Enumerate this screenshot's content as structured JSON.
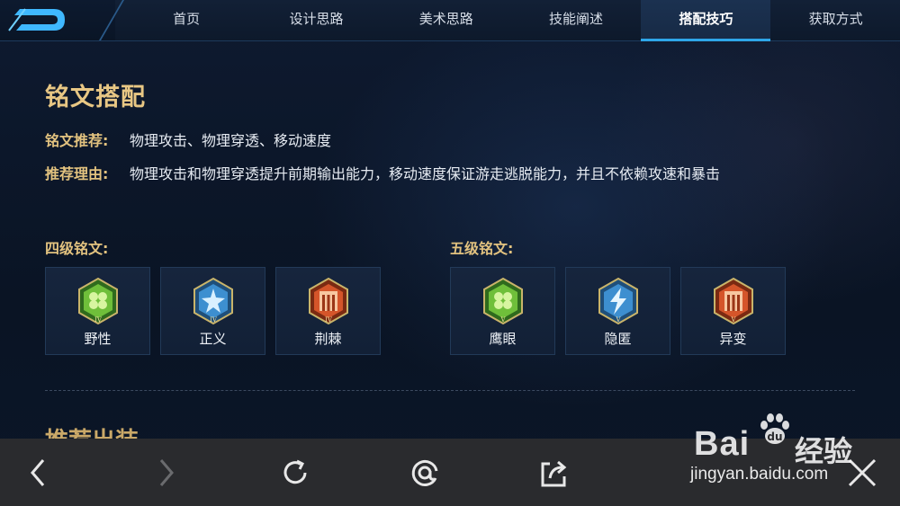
{
  "nav": {
    "tabs": [
      {
        "label": "首页"
      },
      {
        "label": "设计思路"
      },
      {
        "label": "美术思路"
      },
      {
        "label": "技能阐述"
      },
      {
        "label": "搭配技巧"
      },
      {
        "label": "获取方式"
      }
    ],
    "active_index": 4,
    "accent": "#2ea6e8"
  },
  "section": {
    "title": "铭文搭配",
    "recommend_label": "铭文推荐:",
    "recommend_value": "物理攻击、物理穿透、移动速度",
    "reason_label": "推荐理由:",
    "reason_value": "物理攻击和物理穿透提升前期输出能力，移动速度保证游走逃脱能力，并且不依赖攻速和暴击"
  },
  "level4": {
    "title": "四级铭文:",
    "items": [
      {
        "name": "野性",
        "color": "green",
        "numeral": "IV",
        "icon": "clover-rune-icon"
      },
      {
        "name": "正义",
        "color": "blue",
        "numeral": "IV",
        "icon": "star-rune-icon"
      },
      {
        "name": "荆棘",
        "color": "red",
        "numeral": "IV",
        "icon": "gate-rune-icon"
      }
    ]
  },
  "level5": {
    "title": "五级铭文:",
    "items": [
      {
        "name": "鹰眼",
        "color": "green",
        "numeral": "V",
        "icon": "clover-rune-icon"
      },
      {
        "name": "隐匿",
        "color": "blue",
        "numeral": "V",
        "icon": "lightning-rune-icon"
      },
      {
        "name": "异变",
        "color": "red",
        "numeral": "V",
        "icon": "gate-rune-icon"
      }
    ]
  },
  "next_section_title": "推荐出装",
  "bottom_bar": {
    "buttons": [
      "back-icon",
      "forward-icon",
      "refresh-icon",
      "at-icon",
      "share-icon",
      "close-icon"
    ]
  },
  "watermark": {
    "brand": "Bai",
    "brand_suffix": "经验",
    "url": "jingyan.baidu.com"
  },
  "colors": {
    "gold": "#e2c27f",
    "background": "#0b1426",
    "rune_green": "#6fbf3a",
    "rune_blue": "#3d8fd0",
    "rune_red": "#d5552a"
  }
}
